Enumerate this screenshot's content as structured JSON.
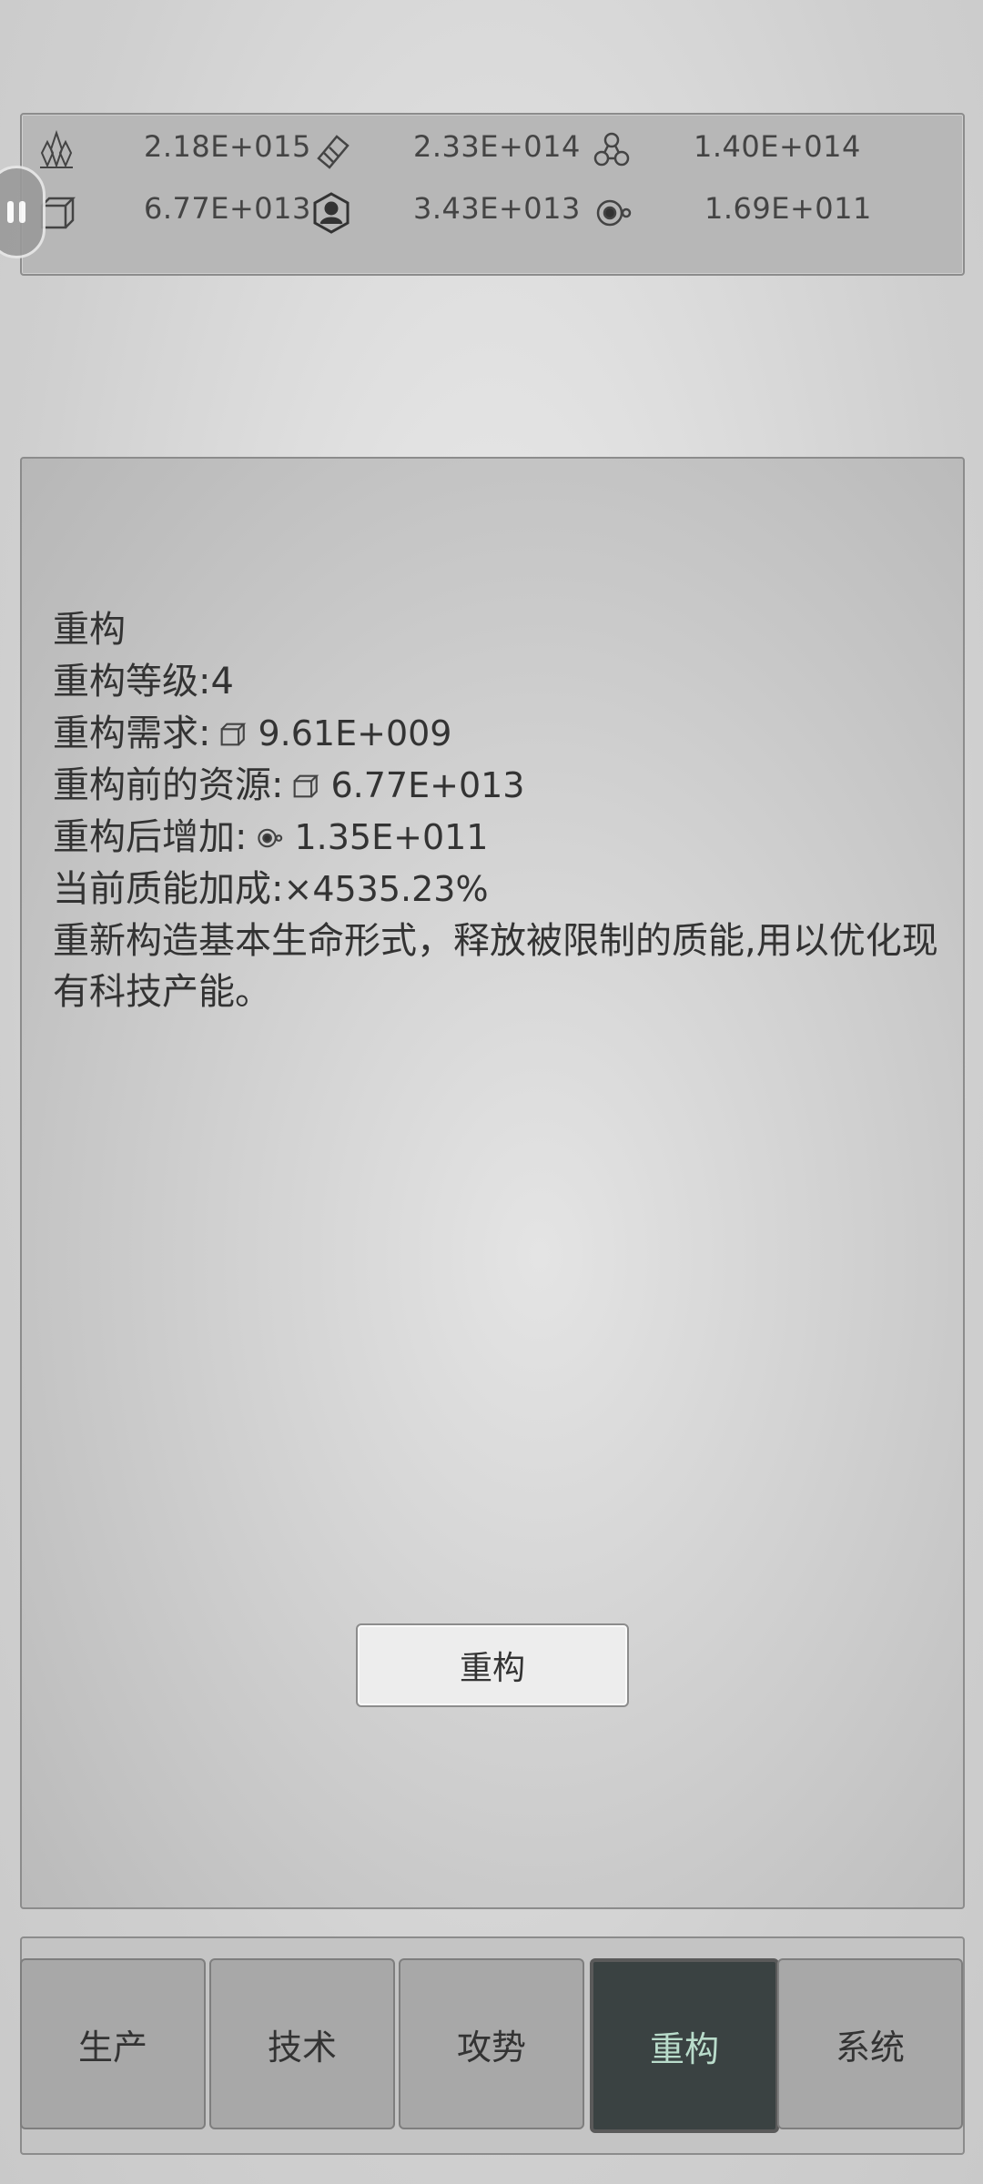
{
  "resources": [
    {
      "icon": "crystal-icon",
      "value": "2.18E+015"
    },
    {
      "icon": "tag-icon",
      "value": "2.33E+014"
    },
    {
      "icon": "molecule-icon",
      "value": "1.40E+014"
    },
    {
      "icon": "cube-icon",
      "value": "6.77E+013"
    },
    {
      "icon": "person-icon",
      "value": "3.43E+013"
    },
    {
      "icon": "eye-orbit-icon",
      "value": "1.69E+011"
    }
  ],
  "rebuild": {
    "title": "重构",
    "level_label": "重构等级:",
    "level_value": "4",
    "requirement_label": "重构需求:",
    "requirement_value": "9.61E+009",
    "requirement_icon": "cube-icon",
    "before_label": "重构前的资源:",
    "before_value": "6.77E+013",
    "before_icon": "cube-icon",
    "gain_label": "重构后增加:",
    "gain_value": "1.35E+011",
    "gain_icon": "eye-orbit-icon",
    "bonus_label": "当前质能加成:",
    "bonus_value": "×4535.23%",
    "description": "重新构造基本生命形式，释放被限制的质能,用以优化现有科技产能。",
    "button_label": "重构"
  },
  "nav": {
    "tabs": [
      {
        "label": "生产",
        "active": false
      },
      {
        "label": "技术",
        "active": false
      },
      {
        "label": "攻势",
        "active": false
      },
      {
        "label": "重构",
        "active": true
      },
      {
        "label": "系统",
        "active": false
      }
    ]
  },
  "colors": {
    "active_tab_bg": "#3a4242",
    "active_tab_text": "#b9dccb",
    "panel_border": "#8c8c8c"
  }
}
